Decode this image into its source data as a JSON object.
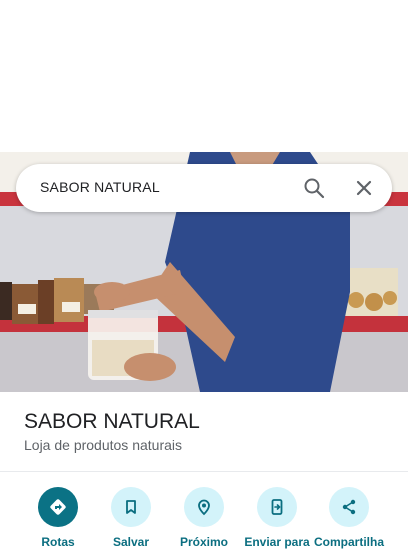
{
  "search": {
    "query": "SABOR NATURAL"
  },
  "place": {
    "name": "SABOR NATURAL",
    "category": "Loja de produtos naturais"
  },
  "actions": [
    {
      "label": "Rotas",
      "icon": "directions-icon"
    },
    {
      "label": "Salvar",
      "icon": "bookmark-icon"
    },
    {
      "label": "Próximo",
      "icon": "nearby-icon"
    },
    {
      "label": "Enviar para",
      "icon": "send-to-phone-icon"
    },
    {
      "label": "Compartilha",
      "icon": "share-icon"
    }
  ],
  "colors": {
    "accent": "#0b7285",
    "action_bg": "#d3f3fa",
    "label": "#0b6e80"
  }
}
